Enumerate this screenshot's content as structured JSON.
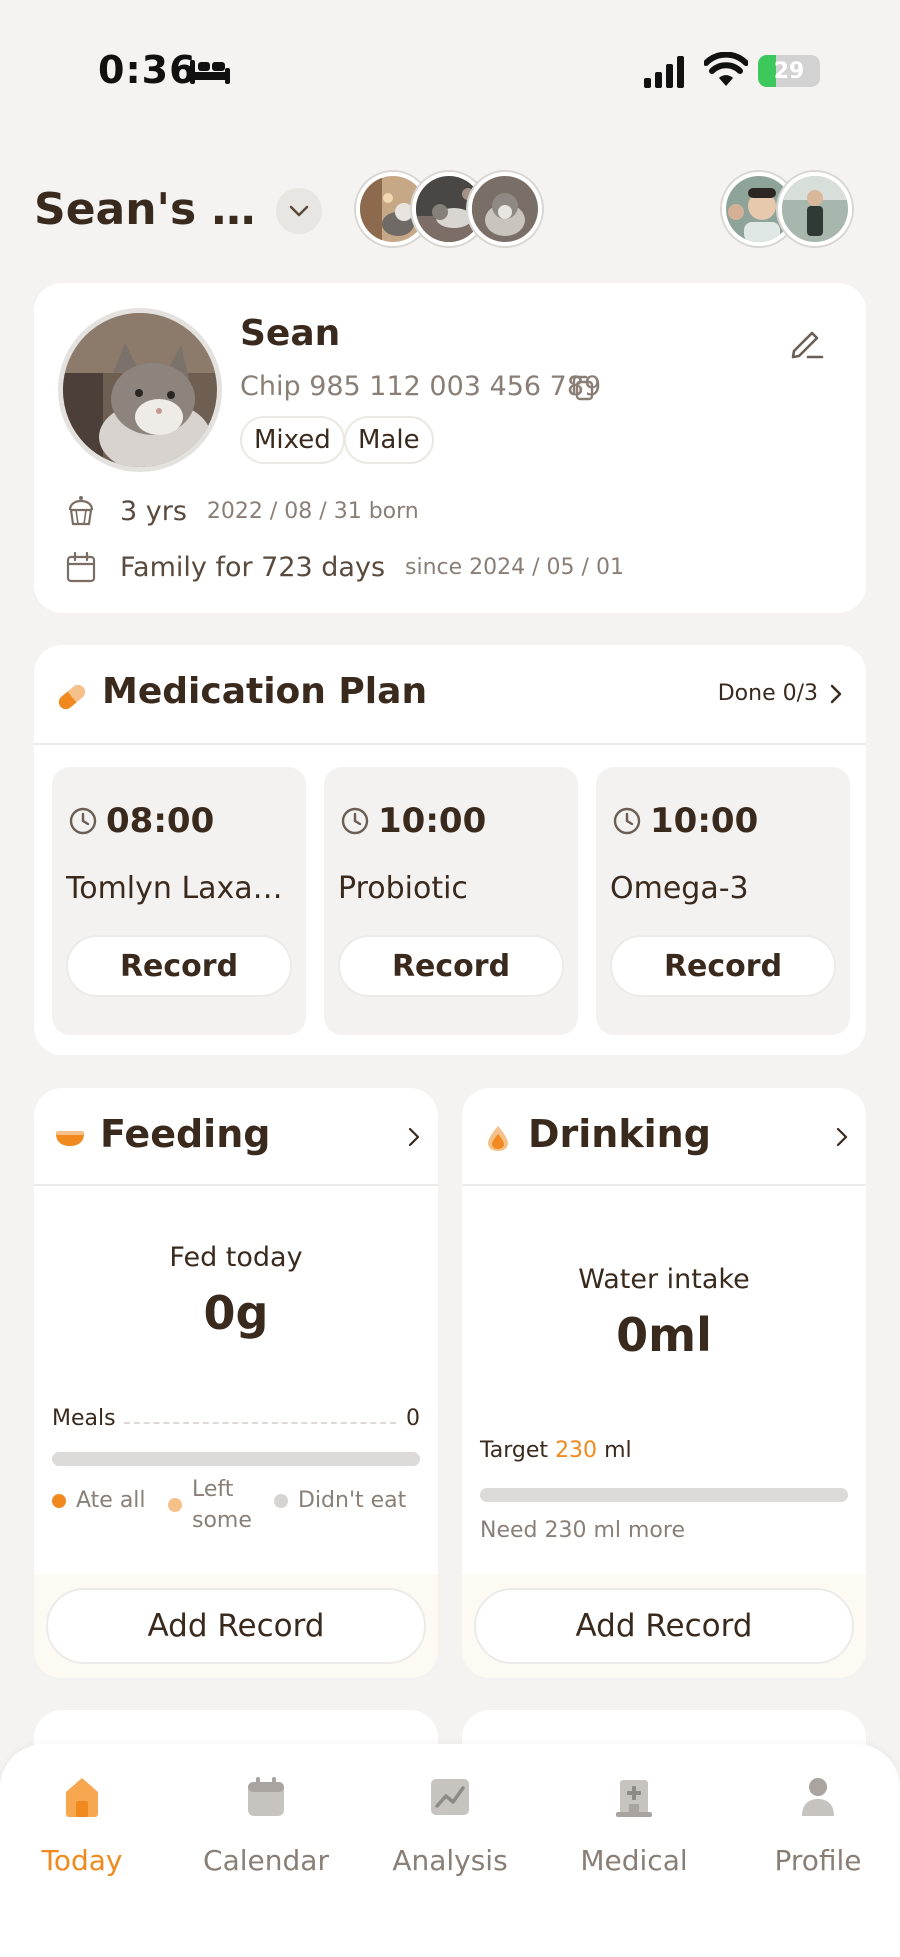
{
  "status_bar": {
    "time": "0:36",
    "battery": "29",
    "battery_level": 0.29
  },
  "header": {
    "title": "Sean's R…"
  },
  "profile": {
    "name": "Sean",
    "chip": "Chip 985 112 003 456 789",
    "tags": [
      "Mixed",
      "Male"
    ],
    "age": "3 yrs",
    "born": "2022 / 08 / 31 born",
    "family": "Family for 723 days",
    "since": "since 2024 / 05 / 01"
  },
  "medication": {
    "title": "Medication Plan",
    "done": "Done 0/3",
    "items": [
      {
        "time": "08:00",
        "name": "Tomlyn Laxa…",
        "button": "Record"
      },
      {
        "time": "10:00",
        "name": "Probiotic",
        "button": "Record"
      },
      {
        "time": "10:00",
        "name": "Omega-3",
        "button": "Record"
      }
    ]
  },
  "feeding": {
    "title": "Feeding",
    "label": "Fed today",
    "value": "0g",
    "meals_label": "Meals",
    "meals_count": "0",
    "progress": 0,
    "legend": [
      "Ate all",
      "Left some",
      "Didn't eat"
    ],
    "button": "Add Record"
  },
  "drinking": {
    "title": "Drinking",
    "label": "Water intake",
    "value": "0ml",
    "target_prefix": "Target",
    "target_value": "230",
    "target_unit": "ml",
    "need": "Need 230 ml more",
    "progress": 0,
    "button": "Add Record"
  },
  "tabs": [
    {
      "label": "Today",
      "icon": "home-icon",
      "active": true
    },
    {
      "label": "Calendar",
      "icon": "calendar-icon",
      "active": false
    },
    {
      "label": "Analysis",
      "icon": "chart-icon",
      "active": false
    },
    {
      "label": "Medical",
      "icon": "hospital-icon",
      "active": false
    },
    {
      "label": "Profile",
      "icon": "person-icon",
      "active": false
    }
  ],
  "colors": {
    "accent": "#f08a1e",
    "accent_light": "#f6c08a",
    "text": "#3a2a1e",
    "muted": "#8a7f77",
    "background": "#f4f3f2"
  }
}
